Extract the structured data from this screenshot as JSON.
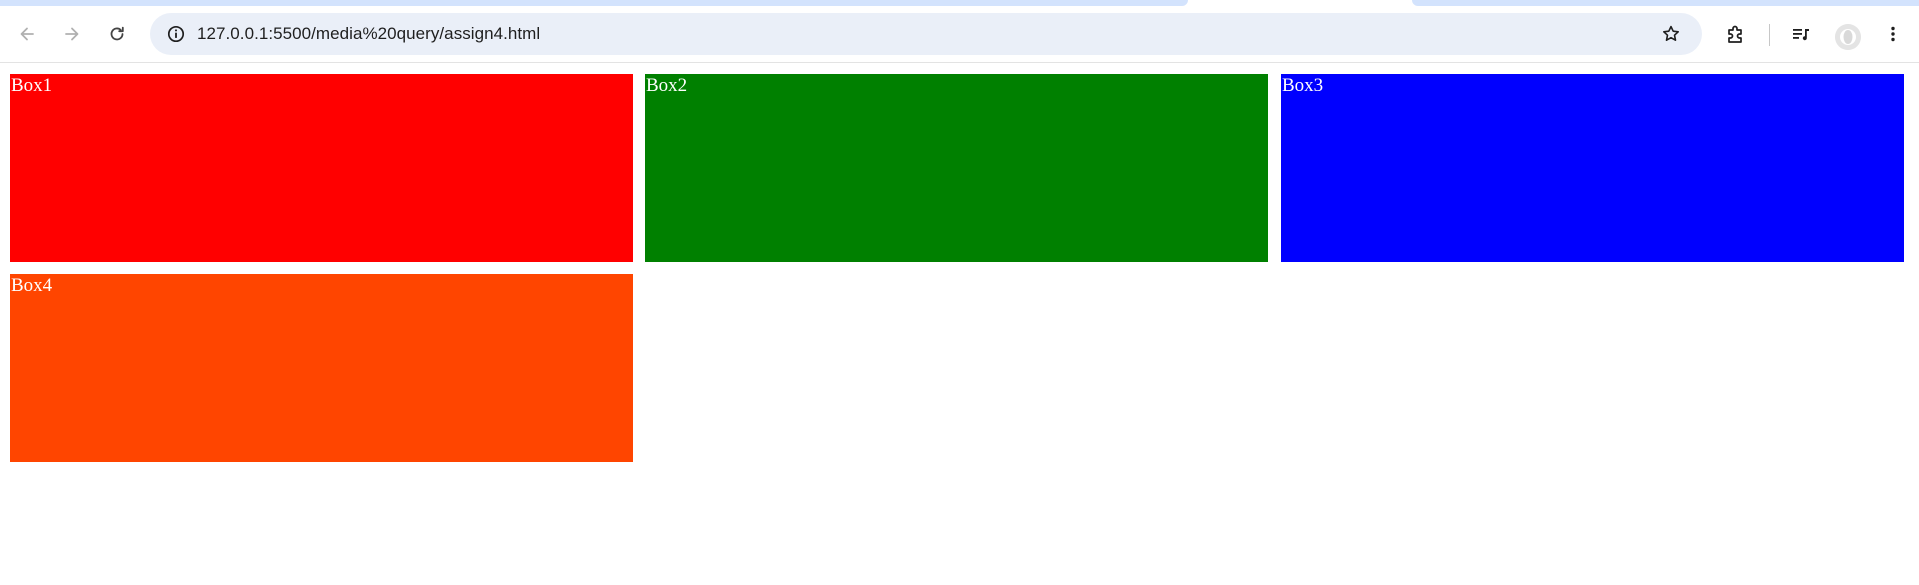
{
  "browser": {
    "url": "127.0.0.1:5500/media%20query/assign4.html"
  },
  "page": {
    "boxes": [
      {
        "label": "Box1",
        "color": "#ff0000"
      },
      {
        "label": "Box2",
        "color": "#008000"
      },
      {
        "label": "Box3",
        "color": "#0000ff"
      },
      {
        "label": "Box4",
        "color": "#ff4500"
      }
    ]
  },
  "icons": {
    "back": "arrow-left-icon",
    "forward": "arrow-right-icon",
    "reload": "reload-icon",
    "site_info": "info-icon",
    "bookmark": "star-icon",
    "extensions": "puzzle-icon",
    "media": "media-queue-icon",
    "profile": "avatar-icon",
    "menu": "kebab-menu-icon"
  },
  "colors": {
    "omnibox_bg": "#eaeff8",
    "tab_bg": "#d3e3fd"
  }
}
